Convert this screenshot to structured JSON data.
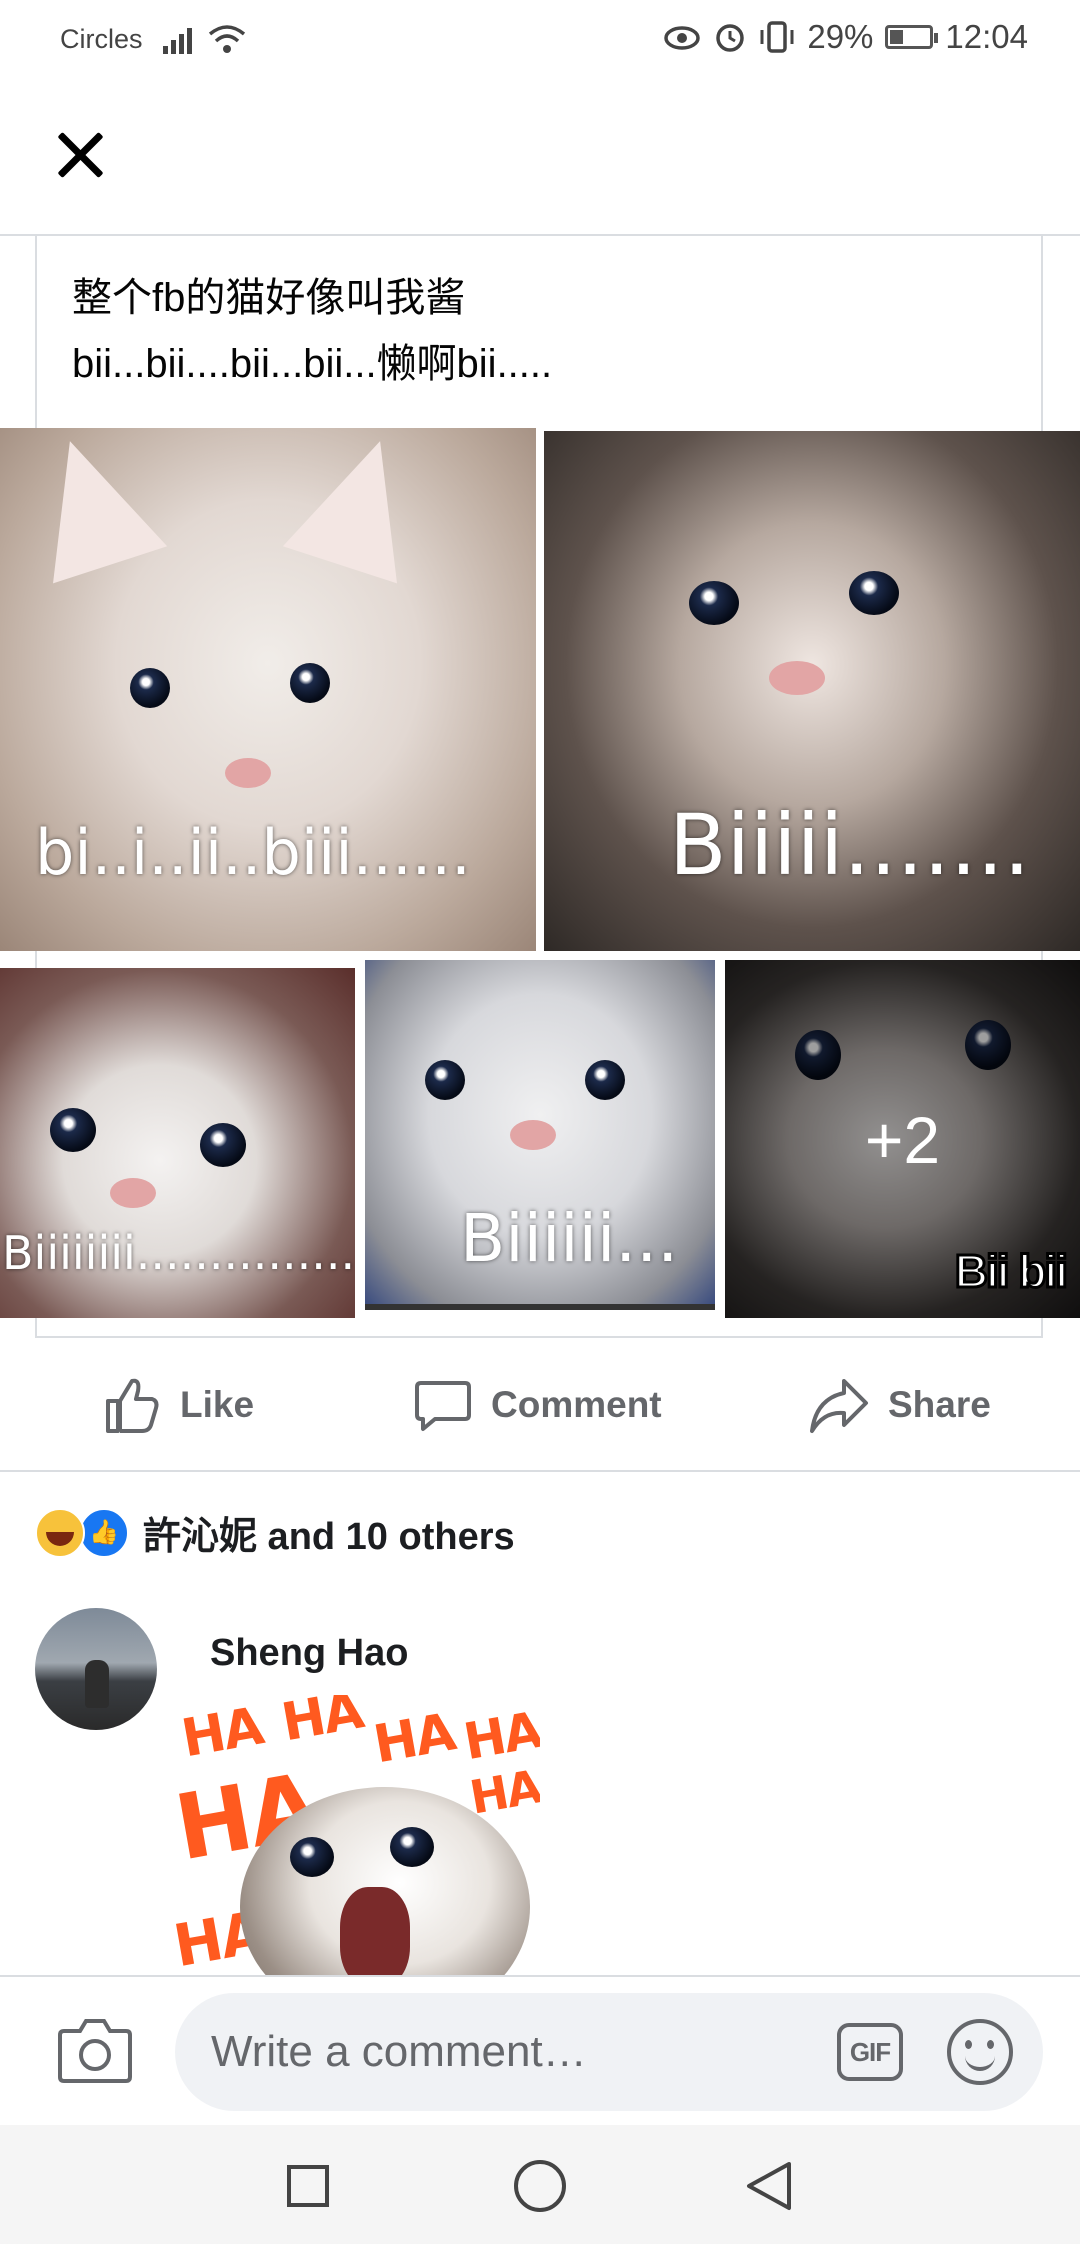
{
  "status_bar": {
    "carrier": "Circles",
    "battery": "29%",
    "time": "12:04"
  },
  "post": {
    "text": "整个fb的猫好像叫我酱\nbii...bii....bii...bii...懒啊bii.....",
    "images": [
      {
        "caption": "bi..i..ii..biii......"
      },
      {
        "caption": "Biiiii......."
      },
      {
        "caption": "Biiiiiiii................"
      },
      {
        "caption": "Biiiiii..."
      },
      {
        "caption": "Bii bii",
        "more_overlay": "+2"
      }
    ]
  },
  "actions": {
    "like": "Like",
    "comment": "Comment",
    "share": "Share"
  },
  "reactions": {
    "summary": "許沁妮 and 10 others"
  },
  "comment": {
    "author": "Sheng Hao",
    "sticker_words": [
      "HA",
      "HA",
      "HA",
      "HA",
      "HA",
      "HA",
      "HA"
    ]
  },
  "composer": {
    "placeholder": "Write a comment…",
    "gif_label": "GIF"
  }
}
